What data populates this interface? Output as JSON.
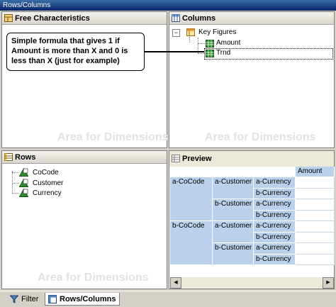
{
  "window": {
    "title": "Rows/Columns"
  },
  "free_characteristics": {
    "title": "Free Characteristics",
    "area_label": "Area for Dimensions"
  },
  "columns": {
    "title": "Columns",
    "area_label": "Area for Dimensions",
    "root_label": "Key Figures",
    "items": [
      "Amount",
      "Trnd"
    ]
  },
  "rows": {
    "title": "Rows",
    "area_label": "Area for Dimensions",
    "items": [
      "CoCode",
      "Customer",
      "Currency"
    ]
  },
  "preview": {
    "title": "Preview",
    "column_header": "Amount",
    "cocode": [
      "a-CoCode",
      "b-CoCode"
    ],
    "customer": [
      "a-Customer",
      "b-Customer",
      "a-Customer",
      "b-Customer"
    ],
    "currency": [
      "a-Currency",
      "b-Currency",
      "a-Currency",
      "b-Currency",
      "a-Currency",
      "b-Currency",
      "a-Currency",
      "b-Currency"
    ]
  },
  "callout": {
    "text": "Simple formula that gives 1 if Amount is more than X and 0 is less than X (just for example)"
  },
  "tabs": [
    {
      "label": "Filter",
      "icon": "filter-icon"
    },
    {
      "label": "Rows/Columns",
      "icon": "rows-columns-icon"
    }
  ],
  "colors": {
    "header_blue": "#b9d1ea",
    "title_bar": "#0a246a",
    "keyfigure_green": "#2e8b2e"
  }
}
